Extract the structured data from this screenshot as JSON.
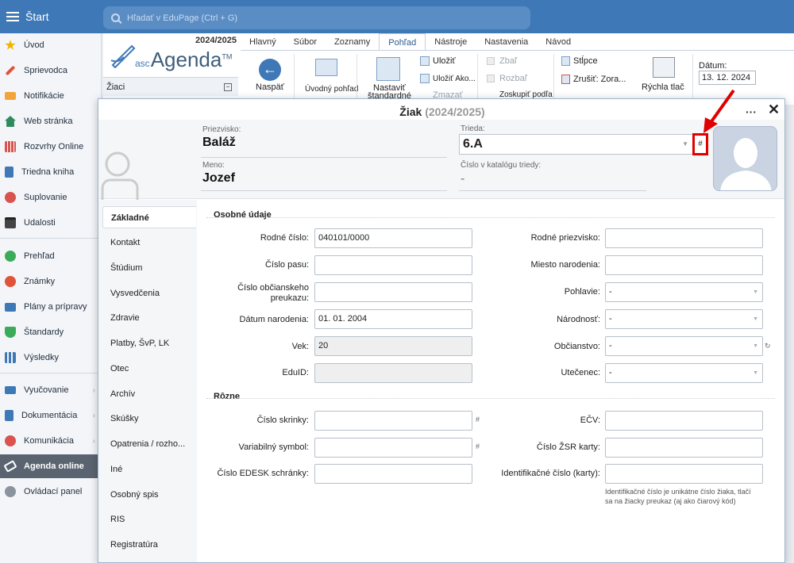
{
  "topbar": {
    "start_label": "Štart",
    "search_placeholder": "Hľadať v EduPage (Ctrl + G)"
  },
  "sidebar": {
    "items": [
      {
        "label": "Úvod",
        "icon": "star-icon"
      },
      {
        "label": "Sprievodca",
        "icon": "wand-icon"
      },
      {
        "label": "Notifikácie",
        "icon": "mail-icon"
      },
      {
        "label": "Web stránka",
        "icon": "home-icon"
      },
      {
        "label": "Rozvrhy Online",
        "icon": "grid-icon"
      },
      {
        "label": "Triedna kniha",
        "icon": "book-icon"
      },
      {
        "label": "Suplovanie",
        "icon": "user-icon"
      },
      {
        "label": "Udalosti",
        "icon": "calendar-icon"
      },
      {
        "label": "Prehľad",
        "icon": "check-icon"
      },
      {
        "label": "Známky",
        "icon": "grade-icon"
      },
      {
        "label": "Plány a prípravy",
        "icon": "briefcase-icon"
      },
      {
        "label": "Štandardy",
        "icon": "shield-icon"
      },
      {
        "label": "Výsledky",
        "icon": "bars-icon"
      },
      {
        "label": "Vyučovanie",
        "icon": "book-open-icon"
      },
      {
        "label": "Dokumentácia",
        "icon": "document-icon"
      },
      {
        "label": "Komunikácia",
        "icon": "chat-icon"
      },
      {
        "label": "Agenda online",
        "icon": "pen-icon"
      },
      {
        "label": "Ovládací panel",
        "icon": "gear-icon"
      }
    ]
  },
  "app": {
    "year": "2024/2025",
    "logo_asc": "asc",
    "logo_name": "Agenda",
    "logo_tm": "TM",
    "section": "Žiaci",
    "tabs": [
      "Hlavný",
      "Súbor",
      "Zoznamy",
      "Pohľad",
      "Nástroje",
      "Nastavenia",
      "Návod"
    ],
    "ribbon": {
      "back": "Naspäť",
      "home_view": "Úvodný pohľad",
      "set_standard_1": "Nastaviť",
      "set_standard_2": "štandardné",
      "save": "Uložiť",
      "save_as": "Uložiť Ako...",
      "delete": "Zmazať",
      "collapse": "Zbaľ",
      "expand": "Rozbaľ",
      "group_by": "Zoskupiť podľa",
      "columns": "Stĺpce",
      "cancel_sort": "Zrušiť: Zora...",
      "quick_print": "Rýchla tlač",
      "date_label": "Dátum:",
      "date_value": "13. 12. 2024"
    }
  },
  "modal": {
    "title": "Žiak",
    "title_year": "(2024/2025)",
    "more": "···",
    "close": "✕",
    "header": {
      "surname_label": "Priezvisko:",
      "surname": "Baláž",
      "name_label": "Meno:",
      "name": "Jozef",
      "class_label": "Trieda:",
      "class": "6.A",
      "catalog_label": "Číslo v katalógu triedy:",
      "catalog": "-",
      "hash": "#"
    },
    "side_tabs": [
      "Základné",
      "Kontakt",
      "Štúdium",
      "Vysvedčenia",
      "Zdravie",
      "Platby, ŠvP, LK",
      "Otec",
      "Archív",
      "Skúšky",
      "Opatrenia / rozho...",
      "Iné",
      "Osobný spis",
      "RIS",
      "Registratúra"
    ],
    "personal": {
      "section": "Osobné údaje",
      "rodne_cislo_label": "Rodné číslo:",
      "rodne_cislo": "040101/0000",
      "cislo_pasu_label": "Číslo pasu:",
      "op_label_1": "Číslo občianskeho",
      "op_label_2": "preukazu:",
      "datum_label": "Dátum narodenia:",
      "datum": "01. 01. 2004",
      "vek_label": "Vek:",
      "vek": "20",
      "eduid_label": "EduID:",
      "rodne_priezvisko_label": "Rodné priezvisko:",
      "miesto_label": "Miesto narodenia:",
      "pohlavie_label": "Pohlavie:",
      "pohlavie": "-",
      "narodnost_label": "Národnosť:",
      "narodnost": "-",
      "obcianstvo_label": "Občianstvo:",
      "obcianstvo": "-",
      "utecenec_label": "Utečenec:",
      "utecenec": "-"
    },
    "misc": {
      "section": "Rôzne",
      "skrinka_label": "Číslo skrinky:",
      "variabilny_label": "Variabilný symbol:",
      "edesk_label": "Číslo EDESK schránky:",
      "ecv_label": "EČV:",
      "zsr_label": "Číslo ŽSR karty:",
      "ident_label": "Identifikačné číslo (karty):",
      "hash": "#",
      "note_1": "Identifikačné číslo je unikátne číslo žiaka, tlačí",
      "note_2": "sa na žiacky preukaz (aj ako čiarový kód)"
    }
  },
  "colors": {
    "accent": "#3e78b7",
    "highlight": "#e00000"
  }
}
